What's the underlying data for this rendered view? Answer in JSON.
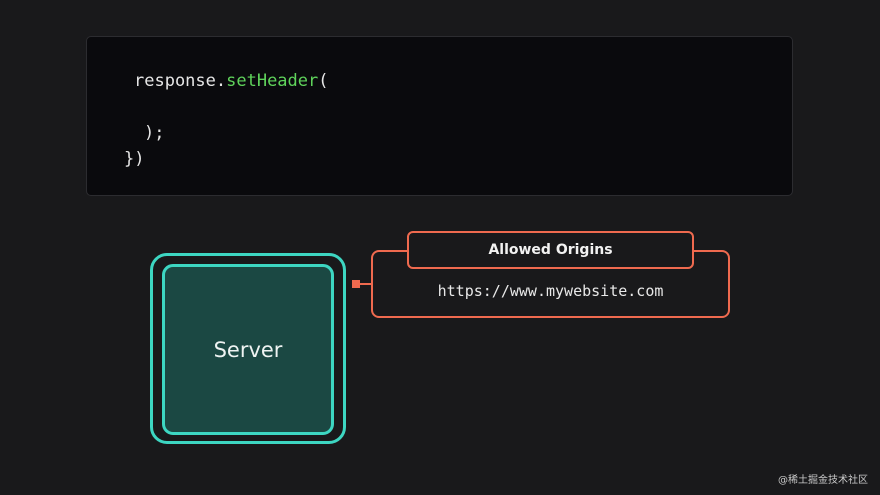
{
  "code": {
    "line1_object": "response.",
    "line1_method": "setHeader",
    "line1_paren": "(",
    "line2": ");",
    "line3": "})"
  },
  "server": {
    "label": "Server"
  },
  "allowed_origins": {
    "title": "Allowed Origins",
    "value": "https://www.mywebsite.com"
  },
  "watermark": "@稀土掘金技术社区",
  "colors": {
    "background": "#19191b",
    "code_method": "#5fd35b",
    "server_accent": "#3dd6c2",
    "server_fill": "#1b4843",
    "origins_accent": "#ef6a4f"
  }
}
